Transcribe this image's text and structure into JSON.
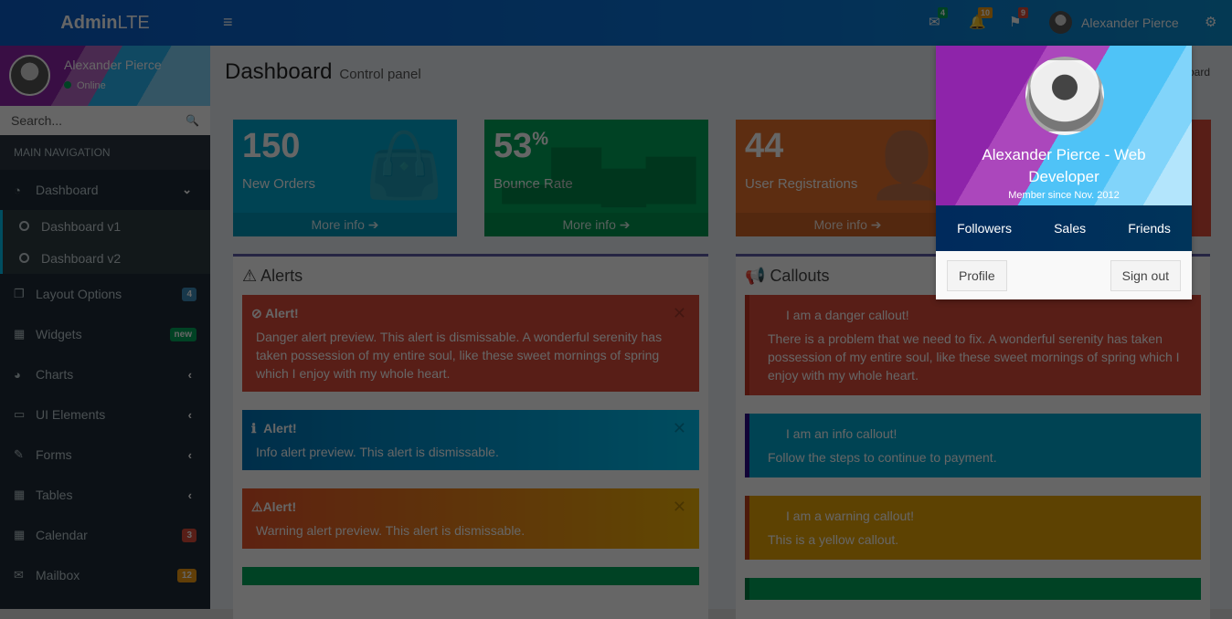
{
  "brand": {
    "bold": "Admin",
    "light": "LTE"
  },
  "navbar": {
    "toggle": "≡",
    "messages": {
      "icon": "✉",
      "count": "4",
      "color": "#00a65a"
    },
    "notifications": {
      "icon": "🔔",
      "count": "10",
      "color": "#f39c12"
    },
    "tasks": {
      "icon": "⚑",
      "count": "9",
      "color": "#dd4b39"
    },
    "user_name": "Alexander Pierce",
    "settings_icon": "⚙"
  },
  "sidebar": {
    "user_name": "Alexander Pierce",
    "status": "Online",
    "search_placeholder": "Search...",
    "search_icon": "🔍",
    "header": "MAIN NAVIGATION",
    "items": [
      {
        "icon": "◔",
        "label": "Dashboard",
        "right": "⌄"
      },
      {
        "icon": "❐",
        "label": "Layout Options",
        "badge": "4",
        "badge_color": "#3c8dbc"
      },
      {
        "icon": "▦",
        "label": "Widgets",
        "badge": "new",
        "badge_color": "#00a65a"
      },
      {
        "icon": "◕",
        "label": "Charts",
        "right": "‹"
      },
      {
        "icon": "▭",
        "label": "UI Elements",
        "right": "‹"
      },
      {
        "icon": "✎",
        "label": "Forms",
        "right": "‹"
      },
      {
        "icon": "▦",
        "label": "Tables",
        "right": "‹"
      },
      {
        "icon": "▦",
        "label": "Calendar",
        "badge": "3",
        "badge_color": "#dd4b39"
      },
      {
        "icon": "✉",
        "label": "Mailbox",
        "badge": "12",
        "badge_color": "#f39c12"
      }
    ],
    "subitems": [
      "Dashboard v1",
      "Dashboard v2"
    ]
  },
  "content": {
    "title": "Dashboard",
    "subtitle": "Control panel",
    "breadcrumb": "Dashboard",
    "info_boxes": [
      {
        "value": "150",
        "label": "New Orders",
        "more": "More info ➔"
      },
      {
        "value": "53",
        "suffix": "%",
        "label": "Bounce Rate",
        "more": "More info ➔"
      },
      {
        "value": "44",
        "label": "User Registrations",
        "more": "More info ➔"
      }
    ],
    "alerts_title": "Alerts",
    "callouts_title": "Callouts",
    "alerts": [
      {
        "title": "Alert!",
        "text": "Danger alert preview. This alert is dismissable. A wonderful serenity has taken possession of my entire soul, like these sweet mornings of spring which I enjoy with my whole heart."
      },
      {
        "title": "Alert!",
        "text": "Info alert preview. This alert is dismissable."
      },
      {
        "title": "Alert!",
        "text": "Warning alert preview. This alert is dismissable."
      }
    ],
    "callouts": [
      {
        "title": "I am a danger callout!",
        "text": "There is a problem that we need to fix. A wonderful serenity has taken possession of my entire soul, like these sweet mornings of spring which I enjoy with my whole heart."
      },
      {
        "title": "I am an info callout!",
        "text": "Follow the steps to continue to payment."
      },
      {
        "title": "I am a warning callout!",
        "text": "This is a yellow callout."
      }
    ]
  },
  "user_dropdown": {
    "name": "Alexander Pierce - Web Developer",
    "since": "Member since Nov. 2012",
    "links": [
      "Followers",
      "Sales",
      "Friends"
    ],
    "profile": "Profile",
    "signout": "Sign out"
  }
}
